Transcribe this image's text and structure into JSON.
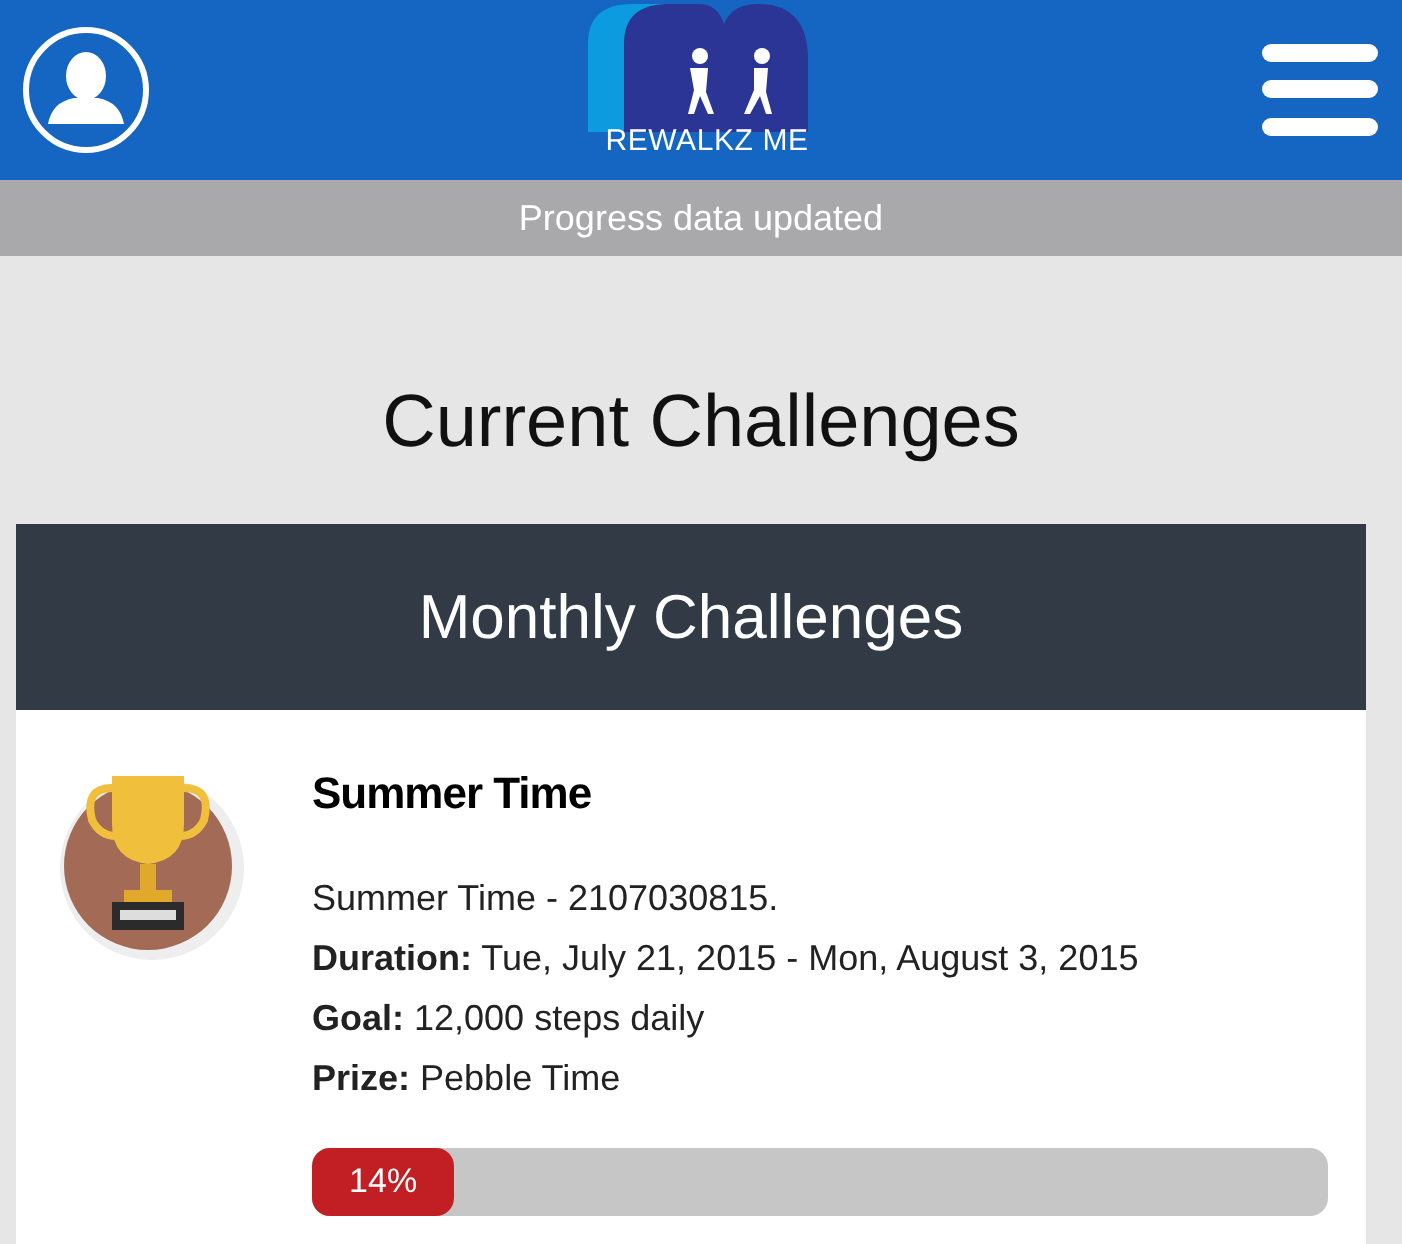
{
  "header": {
    "logo_text": "REWALKZ ME"
  },
  "notice": "Progress data updated",
  "page_title": "Current Challenges",
  "section": {
    "title": "Monthly Challenges",
    "challenges": [
      {
        "name": "Summer Time",
        "description": "Summer Time - 2107030815.",
        "details": [
          "**Duration:** Tue, July 21, 2015 - Mon, August 3, 2015",
          "**Goal:** 12,000 steps daily",
          "**Prize:** Pebble Time"
        ],
        "progress": {
          "level": 0.14,
          "reading": "14%"
        }
      }
    ]
  }
}
